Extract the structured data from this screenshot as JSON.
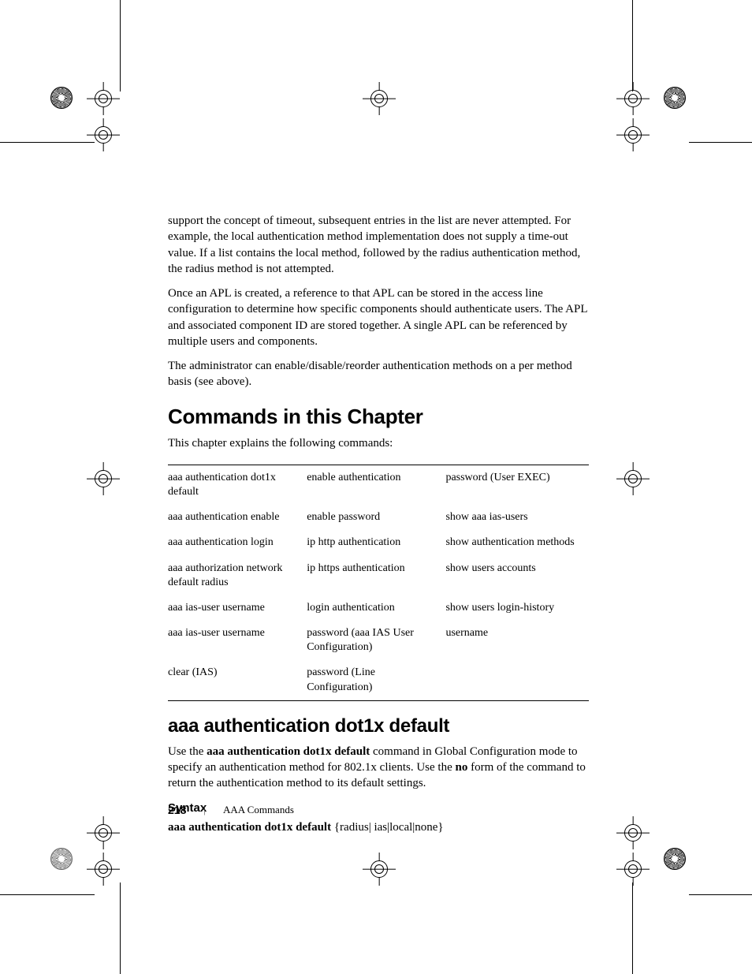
{
  "body": {
    "p1": "support the concept of timeout, subsequent entries in the list are never attempted. For example, the local authentication method implementation does not supply a time-out value. If a list contains the local method, followed by the radius authentication method, the radius method is not attempted.",
    "p2": "Once an APL is created, a reference to that APL can be stored in the access line configuration to determine how specific components should authenticate users. The APL and associated component ID are stored together. A single APL can be referenced by multiple users and components.",
    "p3": "The administrator can enable/disable/reorder authentication methods on a per method basis (see above)."
  },
  "section1": {
    "title": "Commands in this Chapter",
    "intro": "This chapter explains the following commands:",
    "table": [
      [
        "aaa authentication dot1x default",
        "enable authentication",
        "password (User EXEC)"
      ],
      [
        "aaa authentication enable",
        "enable password",
        "show aaa ias-users"
      ],
      [
        "aaa authentication login",
        "ip http authentication",
        "show authentication methods"
      ],
      [
        "aaa authorization network default radius",
        "ip https authentication",
        "show users accounts"
      ],
      [
        "aaa ias-user username",
        "login authentication",
        "show users login-history"
      ],
      [
        "aaa ias-user username",
        "password (aaa IAS User Configuration)",
        "username"
      ],
      [
        "clear (IAS)",
        "password (Line Configuration)",
        ""
      ]
    ]
  },
  "section2": {
    "title": "aaa authentication dot1x default",
    "p1_pre": "Use the ",
    "p1_b1": "aaa authentication dot1x default",
    "p1_mid": " command in Global Configuration mode to specify an authentication method for 802.1x clients. Use the ",
    "p1_b2": "no",
    "p1_post": " form of the command to return the authentication method to its default settings.",
    "syntax_title": "Syntax",
    "syntax_bold": "aaa authentication dot1x default",
    "syntax_rest": " {radius| ias|local|none}"
  },
  "footer": {
    "page": "218",
    "chapter": "AAA Commands"
  }
}
